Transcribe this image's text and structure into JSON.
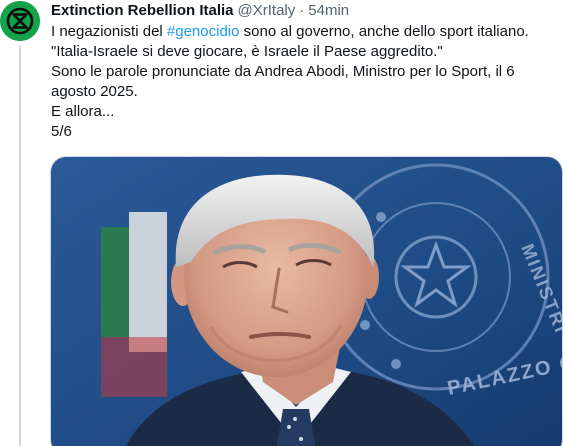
{
  "tweet": {
    "author_name": "Extinction Rebellion Italia",
    "handle": "@XrItaly",
    "separator": "·",
    "time": "54min",
    "text": {
      "line1_pre": "I negazionisti del ",
      "hashtag": "#genocidio",
      "line1_post": " sono al governo, anche dello sport italiano.",
      "line2": "\"Italia-Israele si deve giocare, è Israele il Paese aggredito.\"",
      "line3": "Sono le parole pronunciate da Andrea Abodi, Ministro per lo Sport, il 6 agosto 2025.",
      "line4": "E allora...",
      "line5": "5/6"
    },
    "media": {
      "background_text": "PALAZZO CHIGI",
      "background_text_2": "MINISTRI"
    }
  },
  "colors": {
    "avatar_green": "#13a24a",
    "link_blue": "#1d9bf0",
    "text": "#0f1419",
    "muted": "#536471",
    "photo_backdrop": "#1f4c86"
  },
  "icons": {
    "avatar": "extinction-rebellion-symbol"
  }
}
